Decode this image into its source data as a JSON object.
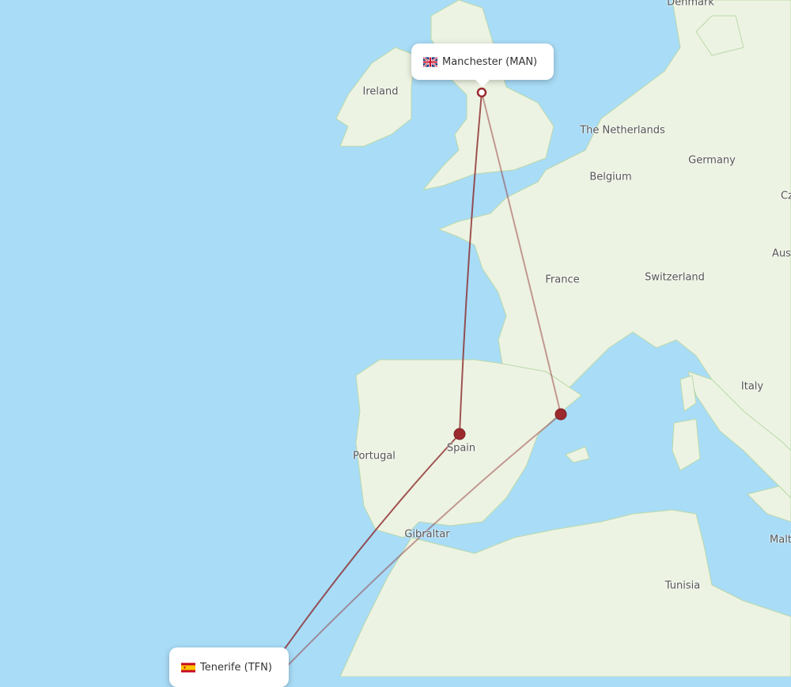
{
  "airports": {
    "origin": {
      "label": "Manchester (MAN)",
      "flag": "uk-flag-icon"
    },
    "destination": {
      "label": "Tenerife (TFN)",
      "flag": "spain-flag-icon"
    }
  },
  "country_labels": [
    "Denmark",
    "Ireland",
    "The Netherlands",
    "Germany",
    "Belgium",
    "Cz",
    "France",
    "Switzerland",
    "Aus",
    "Italy",
    "Portugal",
    "Spain",
    "Gibraltar",
    "Tunisia",
    "Malt"
  ],
  "colors": {
    "ocean": "#a9dcf7",
    "land": "#edf3e3",
    "route": "#8b2a2a",
    "stop": "#9b2a2e"
  },
  "routes": [
    {
      "from": "Manchester",
      "via": "Madrid",
      "to": "Tenerife"
    },
    {
      "from": "Manchester",
      "via": "Barcelona",
      "to": "Tenerife"
    }
  ]
}
